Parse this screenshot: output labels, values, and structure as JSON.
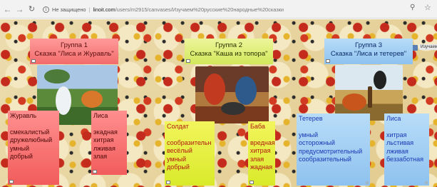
{
  "browser": {
    "security_label": "Не защищено",
    "host": "linoit.com",
    "path": "/users/m2915/canvases/Изучаем%20русские%20народные%20сказки"
  },
  "canvas": {
    "mini_label": "Изучаем"
  },
  "groups": [
    {
      "title_line1": "Группа 1",
      "title_line2": "Сказка \"Лиса и Журавль\"",
      "hero1": "Журавль",
      "hero1_traits": [
        "смекалистый",
        "дружелюбный",
        "умный",
        "добрый"
      ],
      "hero2": "Лиса",
      "hero2_traits": [
        "экадная",
        "хитрая",
        "лживая",
        "злая"
      ]
    },
    {
      "title_line1": "Группа 2",
      "title_line2": "Сказка \"Каша из топора\"",
      "hero1": "Солдат",
      "hero1_traits": [
        "сообразительн",
        "весёлый",
        "умный",
        "добрый"
      ],
      "hero2": "Баба",
      "hero2_traits": [
        "вредная",
        "хитрая",
        "злая",
        "жадная"
      ]
    },
    {
      "title_line1": "Группа 3",
      "title_line2": "Сказка \"Лиса и тетерев\"",
      "hero1": "Тетерев",
      "hero1_traits": [
        "умный",
        "осторожный",
        "предусмотрительный",
        "сообразительный"
      ],
      "hero2": "Лиса",
      "hero2_traits": [
        "хитрая",
        "льстивая",
        "лживая",
        "беззаботная"
      ]
    }
  ]
}
